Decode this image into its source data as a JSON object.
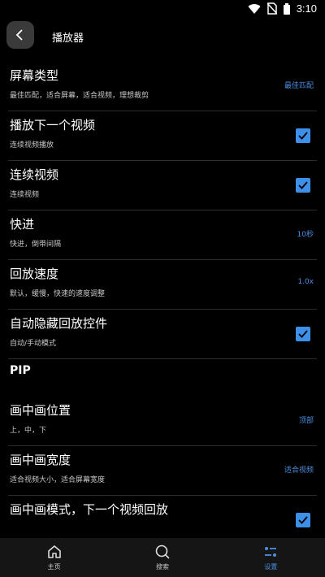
{
  "status": {
    "time": "3:10"
  },
  "header": {
    "title": "播放器"
  },
  "rows_a": [
    {
      "title": "屏幕类型",
      "subtitle": "最佳匹配，适合屏幕，适合视频，理想裁剪",
      "value": "最佳匹配"
    },
    {
      "title": "播放下一个视频",
      "subtitle": "连续视频播放",
      "checked": true
    },
    {
      "title": "连续视频",
      "subtitle": "连续视频",
      "checked": true
    },
    {
      "title": "快进",
      "subtitle": "快进，倒带间隔",
      "value": "10秒"
    },
    {
      "title": "回放速度",
      "subtitle": "默认，缓慢，快速的速度调整",
      "value": "1.0x"
    },
    {
      "title": "自动隐藏回放控件",
      "subtitle": "自动/手动模式",
      "checked": true
    }
  ],
  "pip_section": {
    "title": "PIP"
  },
  "rows_b": [
    {
      "title": "画中画位置",
      "subtitle": "上，中，下",
      "value": "顶部"
    },
    {
      "title": "画中画宽度",
      "subtitle": "适合视频大小，适合屏幕宽度",
      "value": "适合视频"
    },
    {
      "title": "画中画模式，下一个视频回放",
      "checked": true
    }
  ],
  "nav": [
    {
      "label": "主页",
      "icon": "home-icon"
    },
    {
      "label": "搜索",
      "icon": "search-icon"
    },
    {
      "label": "设置",
      "icon": "settings-icon",
      "active": true
    }
  ],
  "colors": {
    "accent": "#3e8fe8",
    "background": "#000000",
    "divider": "#2c2c2c"
  }
}
